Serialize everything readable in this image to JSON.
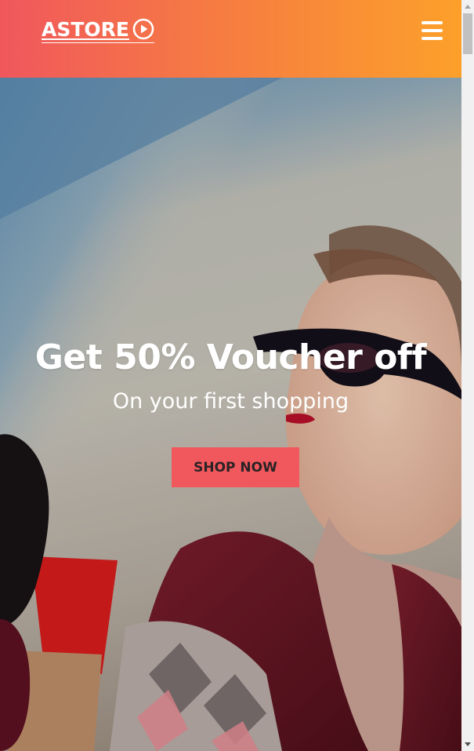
{
  "header": {
    "logo_text": "ASTORE",
    "logo_icon": "play-circle-icon",
    "menu_icon": "hamburger-menu-icon",
    "gradient_start": "#f0575d",
    "gradient_end": "#fca02a"
  },
  "hero": {
    "title": "Get 50% Voucher off",
    "subtitle": "On your first shopping",
    "cta_label": "SHOP NOW",
    "cta_color": "#f0585d"
  }
}
